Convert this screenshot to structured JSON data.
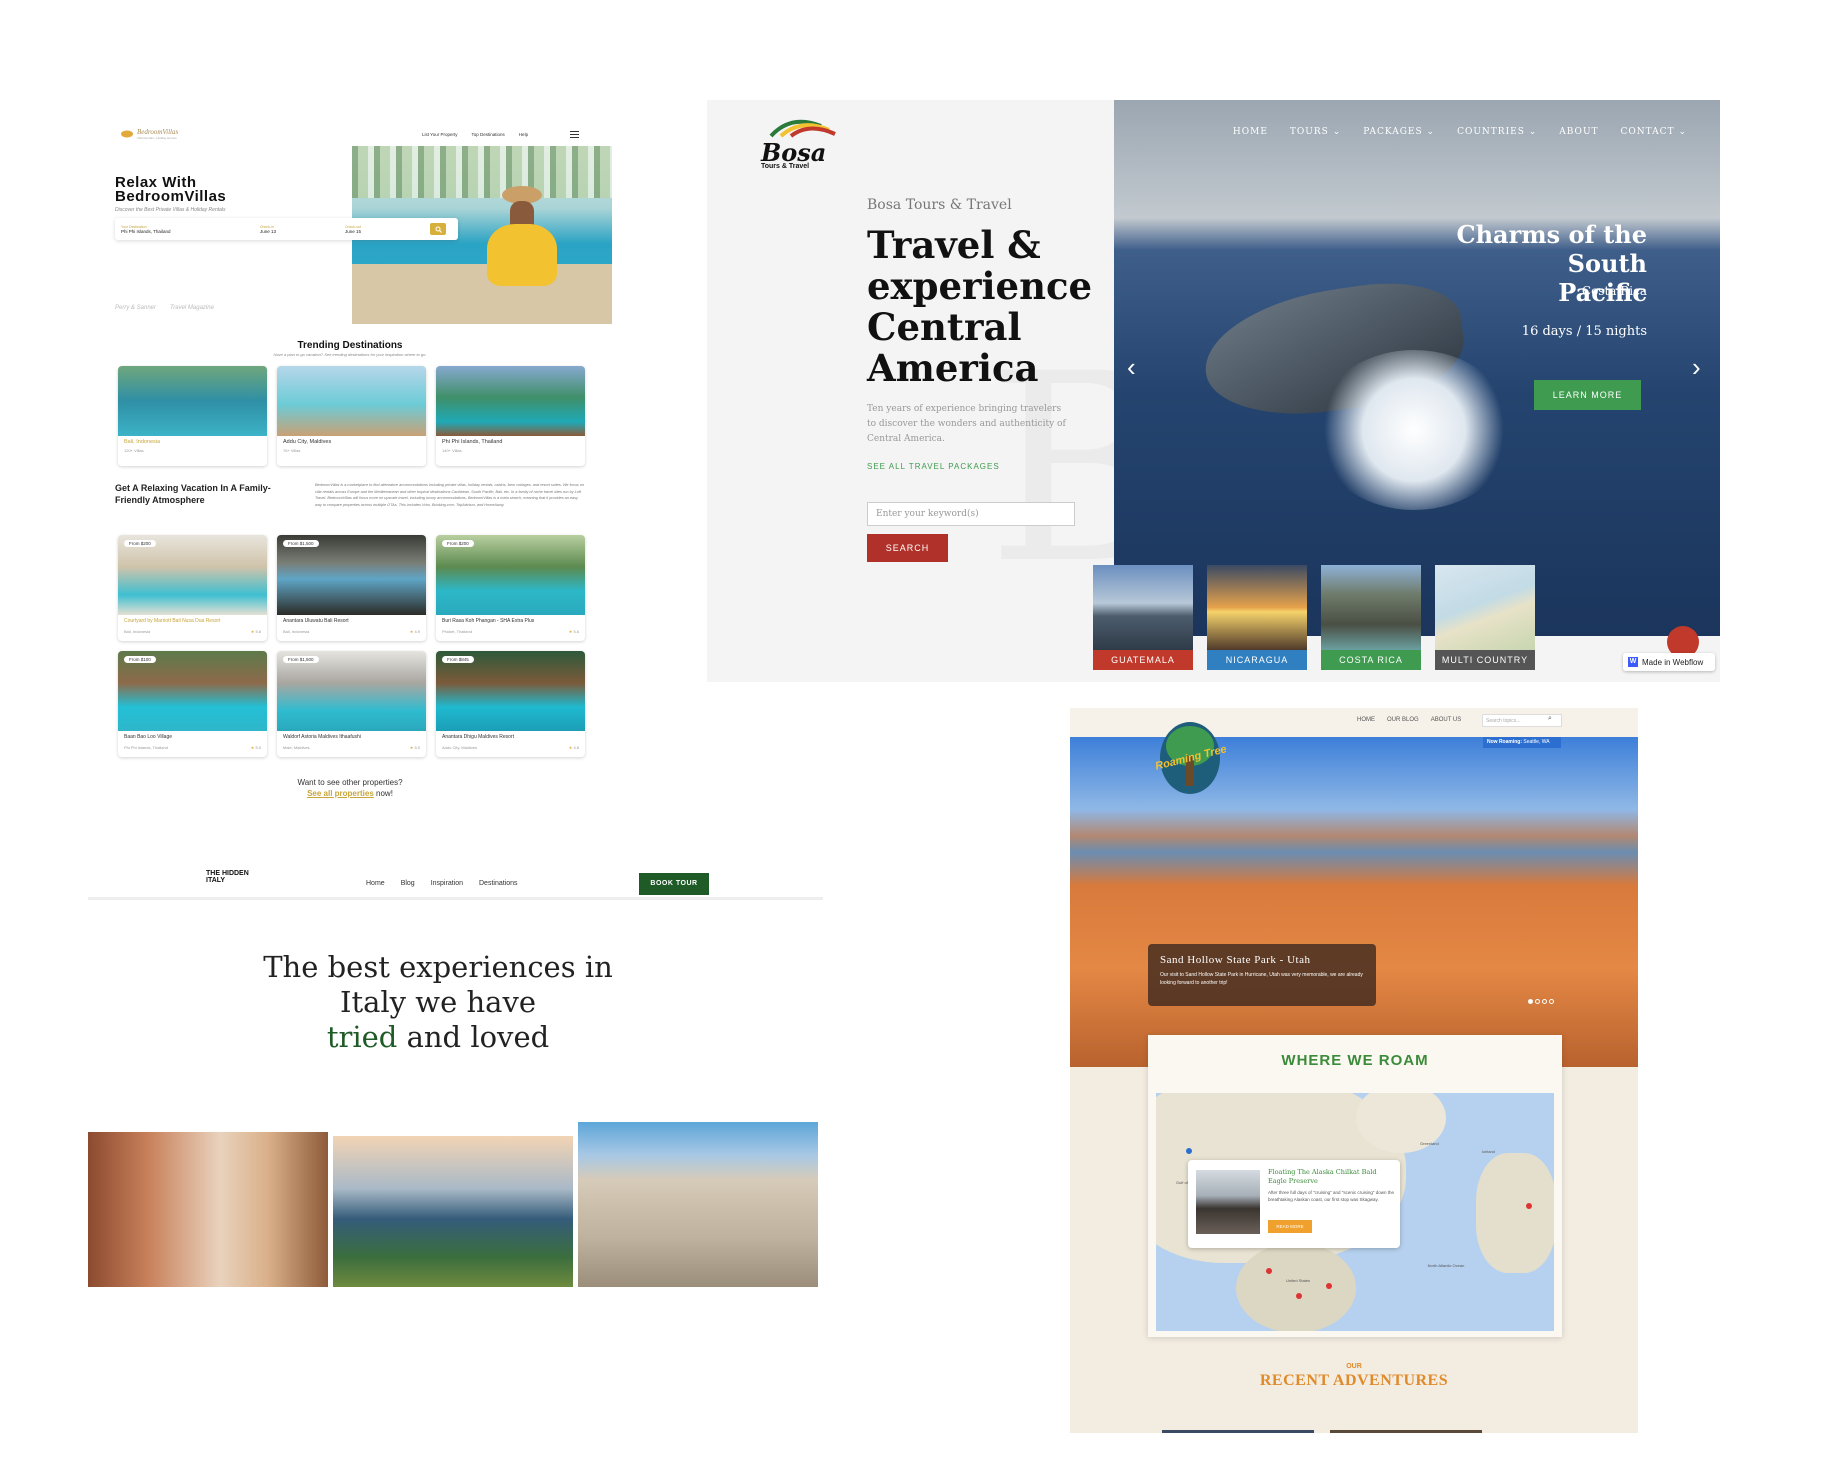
{
  "bedroomvillas": {
    "logo_text": "BedroomVillas",
    "logo_tagline": "Villa Rentals • Holiday Homes",
    "nav": [
      "List Your Property",
      "Top Destinations",
      "Help"
    ],
    "hero_title_line1": "Relax With",
    "hero_title_line2": "BedroomVillas",
    "hero_subtitle": "Discover the Best Private Villas & Holiday Rentals",
    "search": {
      "destination_label": "Your Destination",
      "destination_value": "Phi Phi Islands, Thailand",
      "checkin_label": "Check-in",
      "checkin_value": "June 13",
      "checkout_label": "Check-out",
      "checkout_value": "June 15"
    },
    "partners": [
      "Perry & Sanner",
      "Travel Magazine"
    ],
    "trending_title": "Trending Destinations",
    "trending_subtitle": "Have a plan to go vacation? See trending destinations for your inspiration where to go.",
    "destinations": [
      {
        "name": "Bali, Indonesia",
        "sub": "120+ Villas"
      },
      {
        "name": "Addu City, Maldives",
        "sub": "76+ Villas"
      },
      {
        "name": "Phi Phi Islands, Thailand",
        "sub": "140+ Villas"
      }
    ],
    "about_title": "Get A Relaxing Vacation In A Family-Friendly Atmosphere",
    "about_text": "BedroomVillas is a marketplace to find alternative accommodations including private villas, holiday rentals, cabins, farm cottages, and resort suites. We focus on villa rentals across Europe and the Mediterranean and other tropical destinations Caribbean, South Pacific, Bali, etc. In a family of niche travel sites run by Loft Travel. BedroomVillas will focus more on upscale travel, including luxury accommodations. BedroomVillas is a meta search, meaning that it provides an easy way to compare properties across multiple OTAs. This includes Vrbo, Booking.com, TripAdvisor, and HomeAway.",
    "properties": [
      {
        "price": "From $200",
        "name": "Courtyard by Marriott Bali Nusa Dua Resort",
        "loc": "Bali, Indonesia",
        "rating": "5.6"
      },
      {
        "price": "From $1,500",
        "name": "Anantara Uluwatu Bali Resort",
        "loc": "Bali, Indonesia",
        "rating": "4.9"
      },
      {
        "price": "From $200",
        "name": "Buri Rasa Koh Phangan - SHA Extra Plus",
        "loc": "Phuket, Thailand",
        "rating": "5.6"
      },
      {
        "price": "From $100",
        "name": "Baan Bao Loo Village",
        "loc": "Phi Phi Islands, Thailand",
        "rating": "5.0"
      },
      {
        "price": "From $1,500",
        "name": "Waldorf Astoria Maldives Ithaafushi",
        "loc": "Male, Maldives",
        "rating": "5.0"
      },
      {
        "price": "From $845",
        "name": "Anantara Dhigu Maldives Resort",
        "loc": "Addu City, Maldives",
        "rating": "4.8"
      }
    ],
    "footer_line": "Want to see other properties?",
    "footer_link": "See all properties",
    "footer_suffix": "now!"
  },
  "bosa": {
    "logo_text": "Bosa",
    "logo_sub": "Tours & Travel",
    "nav": [
      "HOME",
      "TOURS",
      "PACKAGES",
      "COUNTRIES",
      "ABOUT",
      "CONTACT"
    ],
    "eyebrow": "Bosa Tours & Travel",
    "headline_1": "Travel &",
    "headline_2": "experience",
    "headline_3": "Central",
    "headline_4": "America",
    "intro": "Ten years of experience bringing travelers to discover the wonders and authenticity of Central America.",
    "packages_link": "SEE ALL TRAVEL PACKAGES",
    "search_placeholder": "Enter your keyword(s)",
    "search_button": "SEARCH",
    "slide_title_1": "Charms of the South",
    "slide_title_2": "Pacific",
    "slide_country": "Costa Rica",
    "slide_duration": "16 days / 15 nights",
    "learn_more": "LEARN MORE",
    "countries": [
      {
        "name": "GUATEMALA",
        "color": "#c0392b"
      },
      {
        "name": "NICARAGUA",
        "color": "#2f7fc1"
      },
      {
        "name": "COSTA RICA",
        "color": "#3e9b4f"
      },
      {
        "name": "MULTI COUNTRY",
        "color": "#555555"
      }
    ],
    "webflow_badge": "Made in Webflow"
  },
  "hidden_italy": {
    "logo_text": "THE HIDDEN ITALY",
    "nav": [
      "Home",
      "Blog",
      "Inspiration",
      "Destinations"
    ],
    "cta": "BOOK TOUR",
    "headline_1": "The best experiences in",
    "headline_2": "Italy we have",
    "headline_accent": "tried",
    "headline_end": "and loved",
    "accent_color": "#1e5b26"
  },
  "roaming_tree": {
    "logo_text": "Roaming Tree",
    "nav": [
      "HOME",
      "OUR BLOG",
      "ABOUT US"
    ],
    "search_placeholder": "Search topics...",
    "now_roaming_label": "Now Roaming:",
    "now_roaming_value": "Seattle, WA",
    "caption_title": "Sand Hollow State Park - Utah",
    "caption_text": "Our visit to Sand Hollow State Park in Hurricane, Utah was very memorable, we are already looking forward to another trip!",
    "where_title": "WHERE WE ROAM",
    "map_popup_title": "Floating The Alaska Chilkat Bald Eagle Preserve",
    "map_popup_text": "After three full days of \"cruising\" and \"scenic cruising\" down the breathtaking Alaskan coast, our first stop was Skagway.",
    "read_more": "READ MORE",
    "map_labels": [
      "Greenland",
      "Iceland",
      "Gulf of Alaska",
      "North Atlantic Ocean",
      "United States"
    ],
    "recent_small": "OUR",
    "recent_title": "RECENT ADVENTURES"
  }
}
